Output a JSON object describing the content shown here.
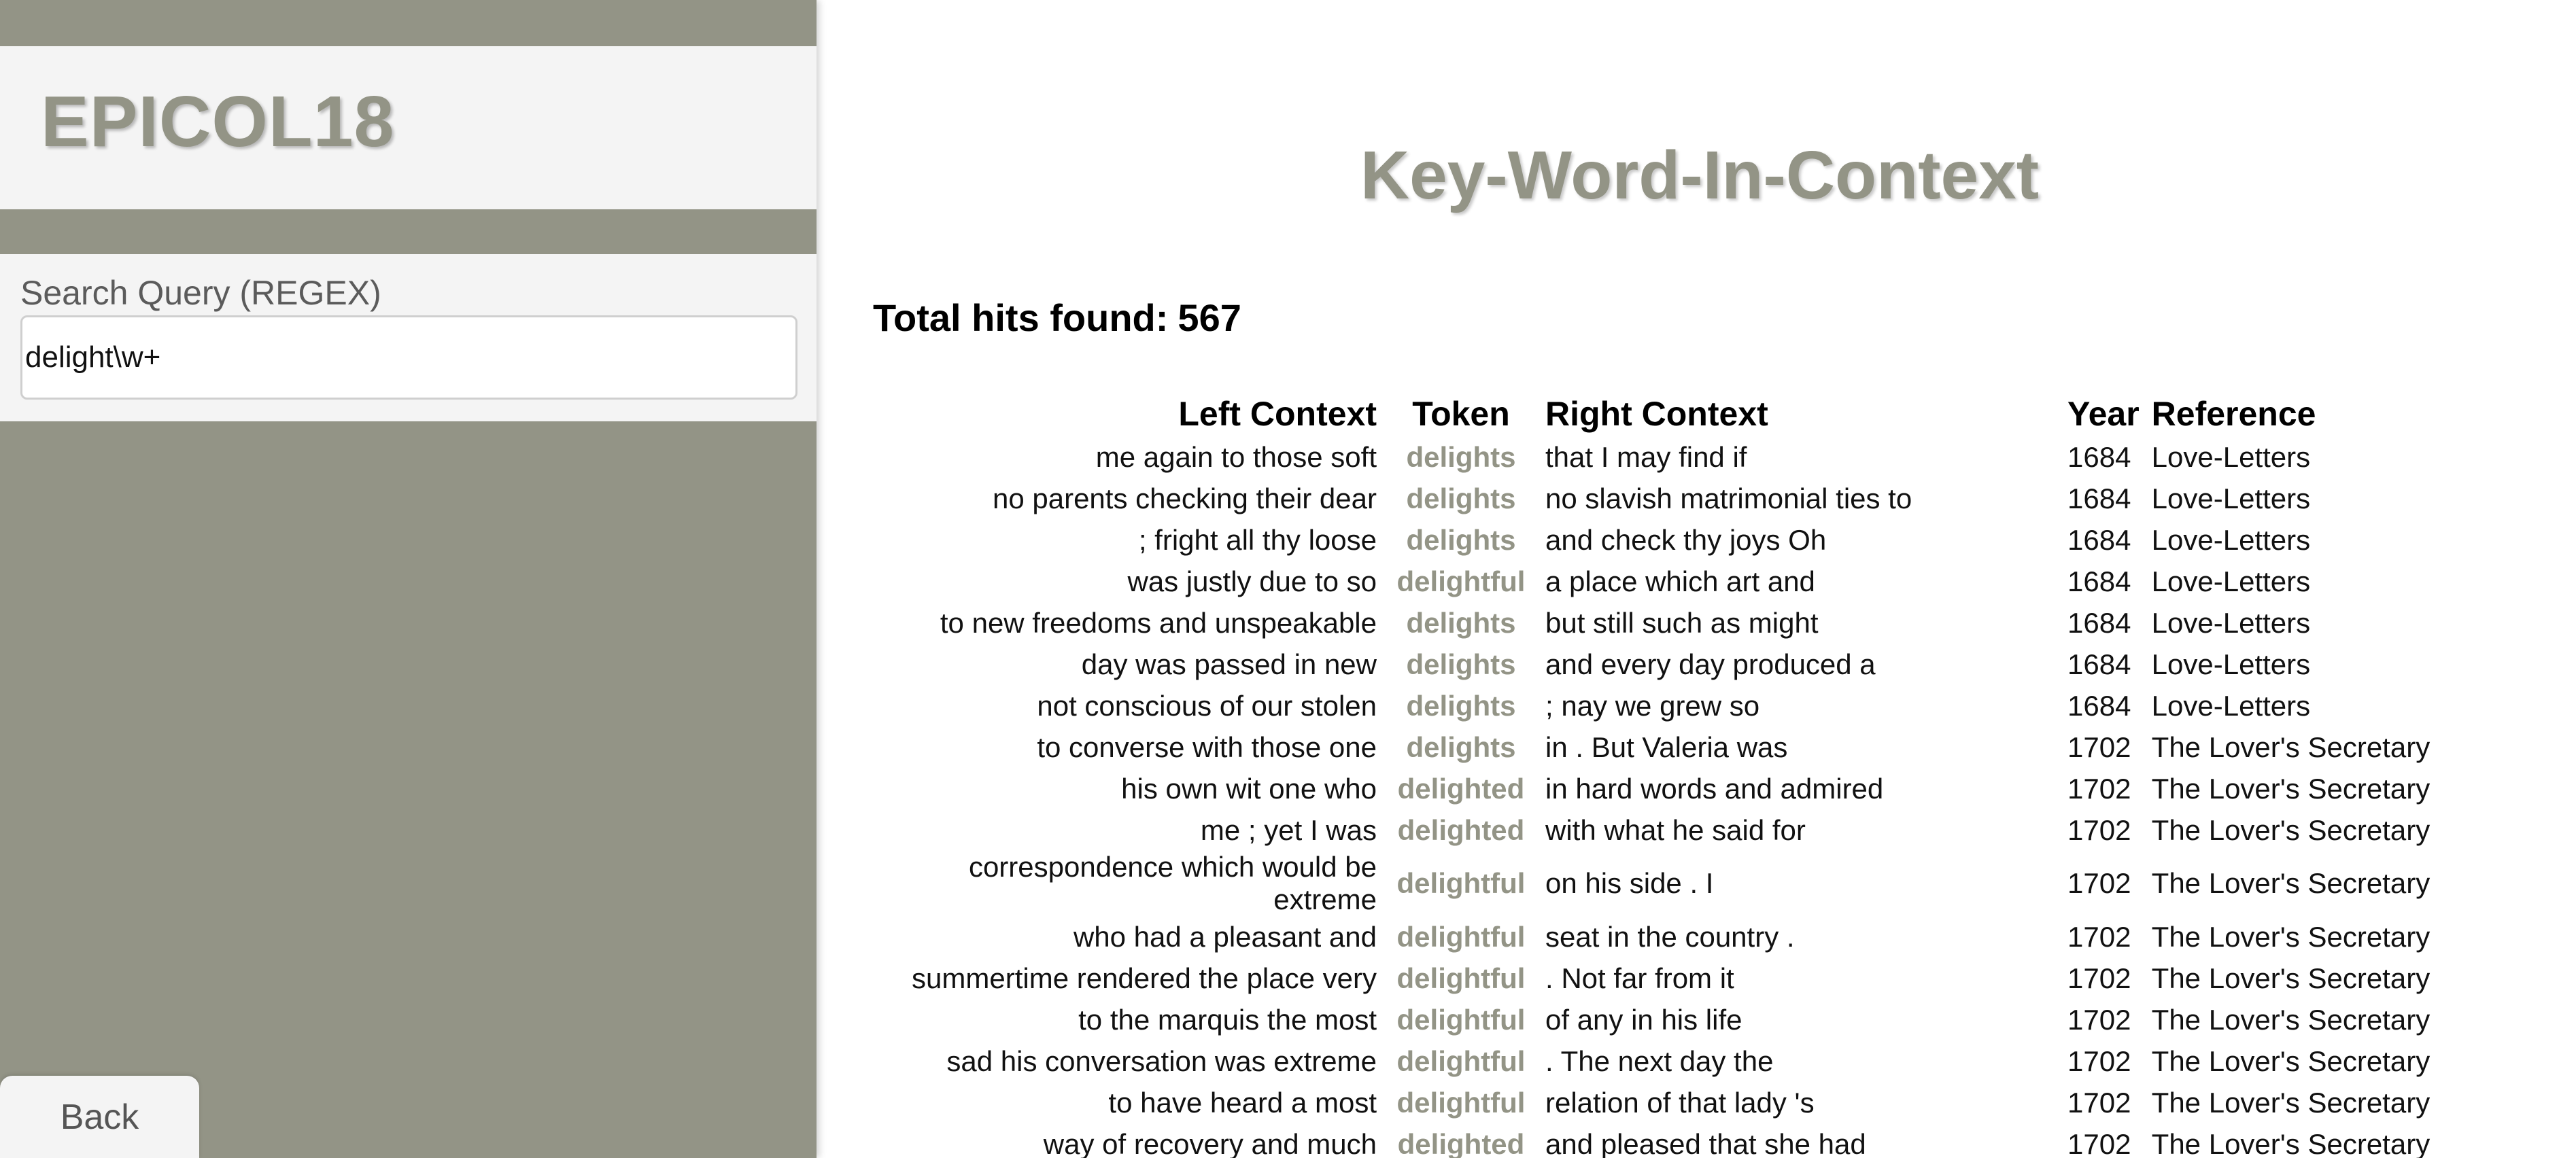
{
  "sidebar": {
    "brand": "EPICOL18",
    "search_label": "Search Query (REGEX)",
    "search_value": "delight\\w+",
    "back_label": "Back"
  },
  "main": {
    "title": "Key-Word-In-Context",
    "total_hits_label": "Total hits found:",
    "total_hits_count": "567"
  },
  "table": {
    "headers": {
      "left": "Left Context",
      "token": "Token",
      "right": "Right Context",
      "year": "Year",
      "reference": "Reference"
    },
    "rows": [
      {
        "left": "me again to those soft",
        "token": "delights",
        "right": "that I may find if",
        "year": "1684",
        "reference": "Love-Letters"
      },
      {
        "left": "no parents checking their dear",
        "token": "delights",
        "right": "no slavish matrimonial ties to",
        "year": "1684",
        "reference": "Love-Letters"
      },
      {
        "left": "; fright all thy loose",
        "token": "delights",
        "right": "and check thy joys Oh",
        "year": "1684",
        "reference": "Love-Letters"
      },
      {
        "left": "was justly due to so",
        "token": "delightful",
        "right": "a place which art and",
        "year": "1684",
        "reference": "Love-Letters"
      },
      {
        "left": "to new freedoms and unspeakable",
        "token": "delights",
        "right": "but still such as might",
        "year": "1684",
        "reference": "Love-Letters"
      },
      {
        "left": "day was passed in new",
        "token": "delights",
        "right": "and every day produced a",
        "year": "1684",
        "reference": "Love-Letters"
      },
      {
        "left": "not conscious of our stolen",
        "token": "delights",
        "right": "; nay we grew so",
        "year": "1684",
        "reference": "Love-Letters"
      },
      {
        "left": "to converse with those one",
        "token": "delights",
        "right": "in . But Valeria was",
        "year": "1702",
        "reference": "The Lover's Secretary"
      },
      {
        "left": "his own wit one who",
        "token": "delighted",
        "right": "in hard words and admired",
        "year": "1702",
        "reference": "The Lover's Secretary"
      },
      {
        "left": "me ; yet I was",
        "token": "delighted",
        "right": "with what he said for",
        "year": "1702",
        "reference": "The Lover's Secretary"
      },
      {
        "left": "correspondence which would be extreme",
        "token": "delightful",
        "right": "on his side . I",
        "year": "1702",
        "reference": "The Lover's Secretary"
      },
      {
        "left": "who had a pleasant and",
        "token": "delightful",
        "right": "seat in the country .",
        "year": "1702",
        "reference": "The Lover's Secretary"
      },
      {
        "left": "summertime rendered the place very",
        "token": "delightful",
        "right": ". Not far from it",
        "year": "1702",
        "reference": "The Lover's Secretary"
      },
      {
        "left": "to the marquis the most",
        "token": "delightful",
        "right": "of any in his life",
        "year": "1702",
        "reference": "The Lover's Secretary"
      },
      {
        "left": "sad his conversation was extreme",
        "token": "delightful",
        "right": ". The next day the",
        "year": "1702",
        "reference": "The Lover's Secretary"
      },
      {
        "left": "to have heard a most",
        "token": "delightful",
        "right": "relation of that lady 's",
        "year": "1702",
        "reference": "The Lover's Secretary"
      },
      {
        "left": "way of recovery and much",
        "token": "delighted",
        "right": "and pleased that she had",
        "year": "1702",
        "reference": "The Lover's Secretary"
      }
    ]
  }
}
